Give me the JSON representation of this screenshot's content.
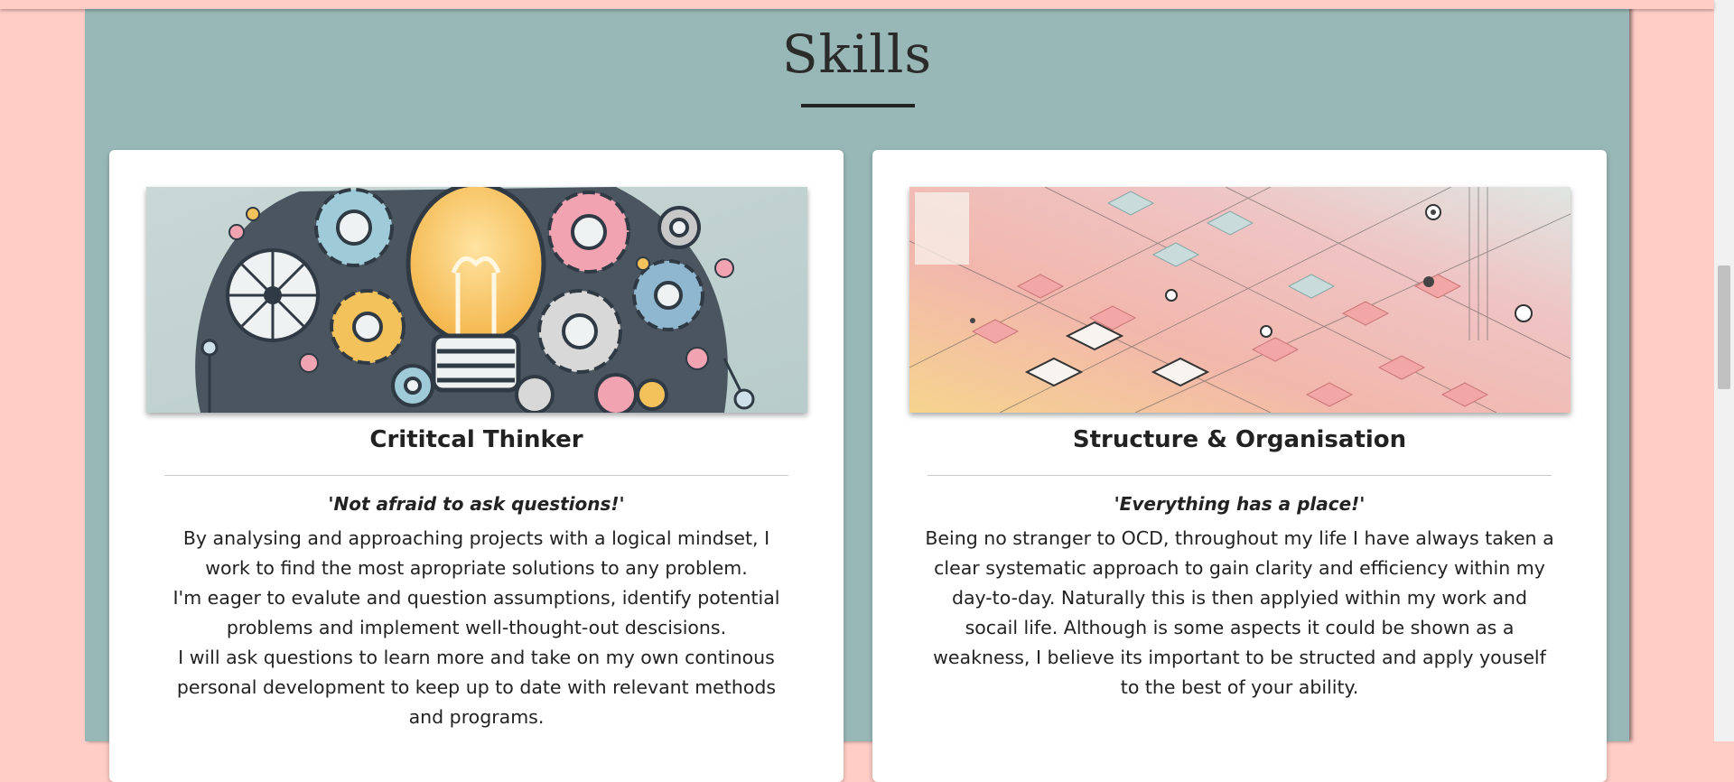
{
  "section": {
    "title": "Skills"
  },
  "cards": [
    {
      "heading": "Crititcal Thinker",
      "quote": "'Not afraid to ask questions!'",
      "paragraphs": [
        "By analysing and approaching projects with a logical mindset, I work to find the most apropriate solutions to any problem.",
        "I'm eager to evalute and question assumptions, identify potential problems and implement well-thought-out descisions.",
        "I will ask questions to learn more and take on my own continous personal development to keep up to date with relevant methods and programs."
      ],
      "image_icon": "lightbulb-gears-illustration"
    },
    {
      "heading": "Structure & Organisation",
      "quote": "'Everything has a place!'",
      "paragraphs": [
        "Being no stranger to OCD, throughout my life I have always taken a clear systematic approach to gain clarity and efficiency within my day-to-day. Naturally this is then applyied within my work and socail life. Although is some aspects it could be shown as a weakness, I believe its important to be structed and apply youself to the best of your ability."
      ],
      "image_icon": "isometric-network-illustration"
    }
  ],
  "colors": {
    "page_background": "#ffcdc6",
    "section_background": "#98b8b7",
    "card_background": "#ffffff",
    "text": "#222222"
  }
}
